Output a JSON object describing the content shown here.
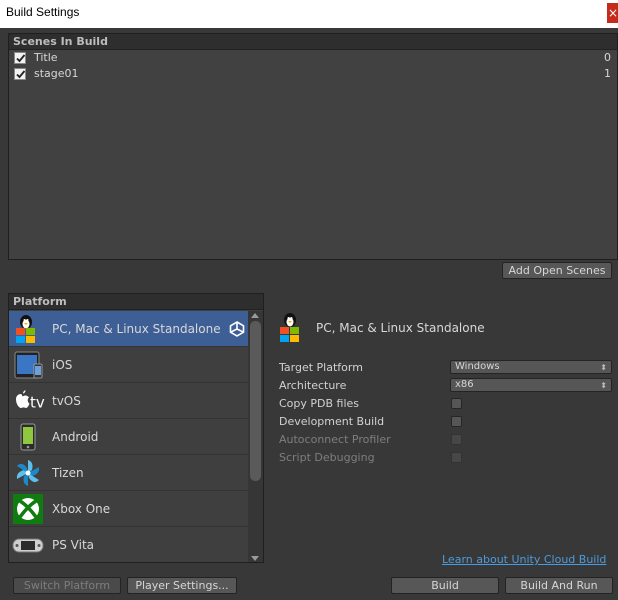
{
  "window": {
    "title": "Build Settings",
    "close_glyph": "×"
  },
  "scenes": {
    "header": "Scenes In Build",
    "items": [
      {
        "name": "Title",
        "index": "0",
        "checked": true
      },
      {
        "name": "stage01",
        "index": "1",
        "checked": true
      }
    ],
    "add_open_scenes_label": "Add Open Scenes"
  },
  "platform": {
    "header": "Platform",
    "items": [
      {
        "label": "PC, Mac & Linux Standalone",
        "icon": "pc-mac-linux-icon",
        "selected": true,
        "active": true
      },
      {
        "label": "iOS",
        "icon": "ios-icon"
      },
      {
        "label": "tvOS",
        "icon": "tvos-icon",
        "icon_text": "tv"
      },
      {
        "label": "Android",
        "icon": "android-icon"
      },
      {
        "label": "Tizen",
        "icon": "tizen-icon"
      },
      {
        "label": "Xbox One",
        "icon": "xbox-one-icon"
      },
      {
        "label": "PS Vita",
        "icon": "ps-vita-icon"
      }
    ]
  },
  "details": {
    "title": "PC, Mac & Linux Standalone",
    "target_platform": {
      "label": "Target Platform",
      "value": "Windows"
    },
    "architecture": {
      "label": "Architecture",
      "value": "x86"
    },
    "copy_pdb": {
      "label": "Copy PDB files"
    },
    "development_build": {
      "label": "Development Build"
    },
    "autoconnect_profiler": {
      "label": "Autoconnect Profiler",
      "disabled": true
    },
    "script_debugging": {
      "label": "Script Debugging",
      "disabled": true
    }
  },
  "footer": {
    "cloud_link": "Learn about Unity Cloud Build",
    "switch_platform_label": "Switch Platform",
    "player_settings_label": "Player Settings...",
    "build_label": "Build",
    "build_and_run_label": "Build And Run"
  },
  "colors": {
    "background": "#383838",
    "selected": "#3e5f96",
    "link": "#4c9bde"
  }
}
